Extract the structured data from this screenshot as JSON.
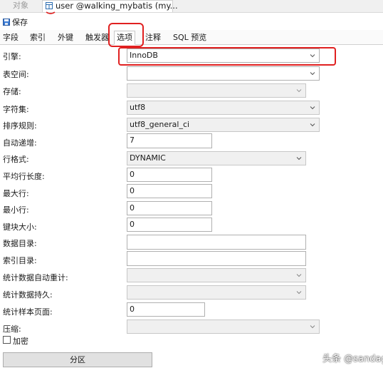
{
  "tabs": {
    "object_label": "对象",
    "active_label": "user @walking_mybatis (my..."
  },
  "toolbar": {
    "save_label": "保存"
  },
  "subtabs": [
    "字段",
    "索引",
    "外键",
    "触发器",
    "选项",
    "注释",
    "SQL 预览"
  ],
  "selected_subtab": "选项",
  "form": {
    "engine": {
      "label": "引擎:",
      "value": "InnoDB"
    },
    "tablespace": {
      "label": "表空间:",
      "value": ""
    },
    "storage": {
      "label": "存储:",
      "value": ""
    },
    "charset": {
      "label": "字符集:",
      "value": "utf8"
    },
    "collation": {
      "label": "排序规则:",
      "value": "utf8_general_ci"
    },
    "auto_increment": {
      "label": "自动递增:",
      "value": "7"
    },
    "row_format": {
      "label": "行格式:",
      "value": "DYNAMIC"
    },
    "avg_row_length": {
      "label": "平均行长度:",
      "value": "0"
    },
    "max_rows": {
      "label": "最大行:",
      "value": "0"
    },
    "min_rows": {
      "label": "最小行:",
      "value": "0"
    },
    "key_block_size": {
      "label": "键块大小:",
      "value": "0"
    },
    "data_directory": {
      "label": "数据目录:",
      "value": ""
    },
    "index_directory": {
      "label": "索引目录:",
      "value": ""
    },
    "stats_auto_recalc": {
      "label": "统计数据自动重计:",
      "value": ""
    },
    "stats_persistent": {
      "label": "统计数据持久:",
      "value": ""
    },
    "stats_sample_pages": {
      "label": "统计样本页面:",
      "value": "0"
    },
    "compression": {
      "label": "压缩:",
      "value": ""
    },
    "encryption": {
      "label": "加密",
      "checked": false
    }
  },
  "partition_button": "分区",
  "watermark": "头条 @sandag",
  "colors": {
    "highlight_red": "#e02020",
    "disabled_bg": "#f0f0f0"
  }
}
